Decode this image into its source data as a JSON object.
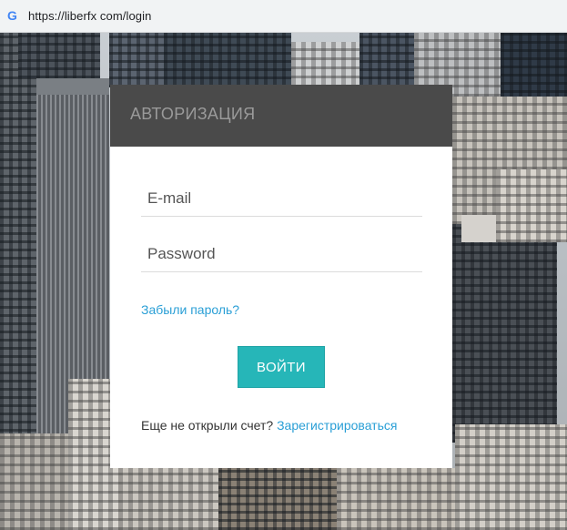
{
  "browser": {
    "url": "https://liberfx com/login",
    "site_icon": "google-g-icon"
  },
  "login": {
    "title": "АВТОРИЗАЦИЯ",
    "email_placeholder": "E-mail",
    "password_placeholder": "Password",
    "forgot_link": "Забыли пароль?",
    "submit_label": "ВОЙТИ",
    "no_account_text": "Еще не открыли счет?",
    "register_link": "Зарегистрироваться"
  },
  "colors": {
    "header_bg": "#4a4a4a",
    "accent_button": "#26b6b8",
    "link": "#2a9fd6"
  }
}
